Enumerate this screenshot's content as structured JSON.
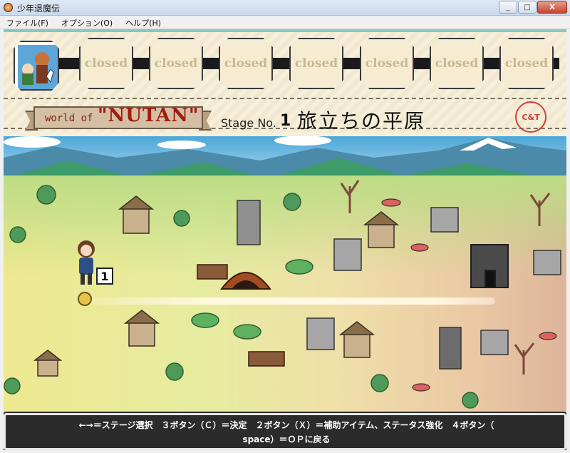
{
  "window": {
    "title": "少年退魔伝",
    "buttons": [
      "_",
      "□",
      "X"
    ]
  },
  "menu": {
    "items": [
      "ファイル(F)",
      "オプション(O)",
      "ヘルプ(H)"
    ]
  },
  "header": {
    "stage_cards": [
      "closed",
      "closed",
      "closed",
      "closed",
      "closed",
      "closed",
      "closed"
    ],
    "world_prefix": "world of",
    "world_name": "\"NUTAN\"",
    "stage_label": "Stage No.",
    "stage_number": "1",
    "stage_title": "旅立ちの平原",
    "stamp_text": "C&T"
  },
  "map": {
    "current_node": "1"
  },
  "footer": {
    "help_line1": "←→＝ステージ選択　３ボタン（Ｃ）＝決定　２ボタン（Ｘ）＝補助アイテム、ステータス強化　４ボタン（",
    "help_line2": "space）＝ＯＰに戻る"
  },
  "colors": {
    "header_accent": "#83c8c2",
    "world_name": "#a11d0e",
    "stamp": "#d0403f"
  }
}
